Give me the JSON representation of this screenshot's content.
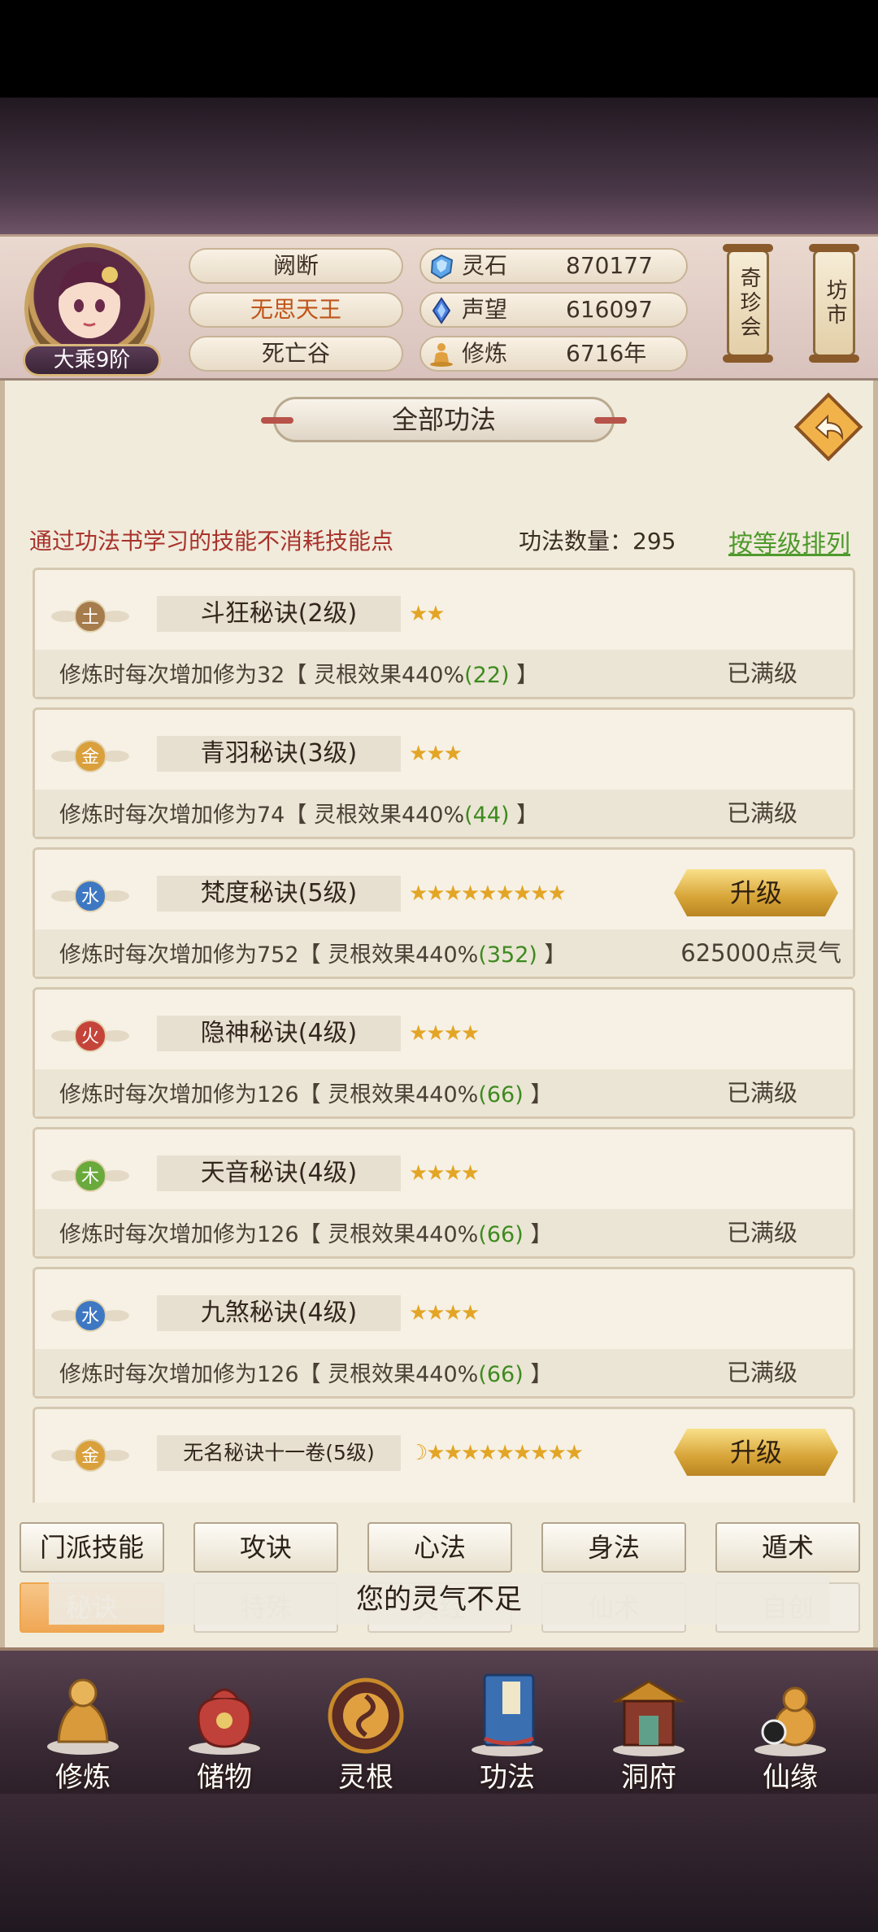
{
  "header": {
    "rank": "大乘9阶",
    "player_fields": [
      "阙断",
      "无思天王",
      "死亡谷"
    ],
    "stats": [
      {
        "label": "灵石",
        "value": "870177",
        "icon": "spirit-stone-icon"
      },
      {
        "label": "声望",
        "value": "616097",
        "icon": "reputation-crystal-icon"
      },
      {
        "label": "修炼",
        "value": "6716年",
        "icon": "meditation-icon"
      }
    ],
    "side_buttons": [
      "奇珍会",
      "坊市"
    ]
  },
  "panel": {
    "title": "全部功法",
    "hint": "通过功法书学习的技能不消耗技能点",
    "count_label": "功法数量：295",
    "sort_link": "按等级排列",
    "upgrade_label": "升级"
  },
  "skills": [
    {
      "element": "土",
      "name": "斗狂秘诀(2级)",
      "stars": "★★",
      "desc_pre": "修炼时每次增加修为32【 灵根效果440%",
      "desc_green": "(22)",
      "desc_post": " 】",
      "status": "已满级"
    },
    {
      "element": "金",
      "name": "青羽秘诀(3级)",
      "stars": "★★★",
      "desc_pre": "修炼时每次增加修为74【 灵根效果440%",
      "desc_green": "(44)",
      "desc_post": " 】",
      "status": "已满级"
    },
    {
      "element": "水",
      "name": "梵度秘诀(5级)",
      "stars": "★★★★★★★★★",
      "desc_pre": "修炼时每次增加修为752【 灵根效果440%",
      "desc_green": "(352)",
      "desc_post": " 】",
      "status": "625000点灵气"
    },
    {
      "element": "火",
      "name": "隐神秘诀(4级)",
      "stars": "★★★★",
      "desc_pre": "修炼时每次增加修为126【 灵根效果440%",
      "desc_green": "(66)",
      "desc_post": " 】",
      "status": "已满级"
    },
    {
      "element": "木",
      "name": "天音秘诀(4级)",
      "stars": "★★★★",
      "desc_pre": "修炼时每次增加修为126【 灵根效果440%",
      "desc_green": "(66)",
      "desc_post": " 】",
      "status": "已满级"
    },
    {
      "element": "水",
      "name": "九煞秘诀(4级)",
      "stars": "★★★★",
      "desc_pre": "修炼时每次增加修为126【 灵根效果440%",
      "desc_green": "(66)",
      "desc_post": " 】",
      "status": "已满级"
    },
    {
      "element": "金",
      "name": "无名秘诀十一卷(5级)",
      "stars": "☽★★★★★★★★★"
    }
  ],
  "tabs_row1": [
    "门派技能",
    "攻诀",
    "心法",
    "身法",
    "遁术"
  ],
  "tabs_row2": [
    "秘诀",
    "特殊",
    "真经",
    "仙术",
    "自创"
  ],
  "toast": "您的灵气不足",
  "nav": [
    "修炼",
    "储物",
    "灵根",
    "功法",
    "洞府",
    "仙缘"
  ],
  "colors": {
    "accent_gold": "#d7a437",
    "hint_red": "#a8332b",
    "link_green": "#4e9a2c",
    "active_tab": "#f09c3e"
  }
}
